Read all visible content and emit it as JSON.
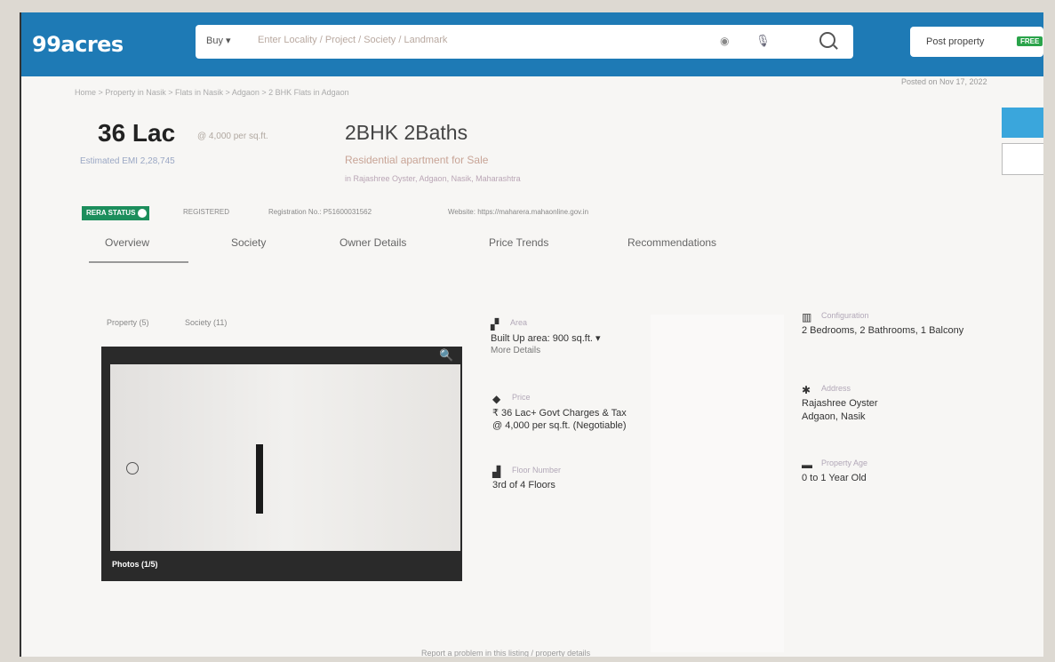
{
  "header": {
    "logo": "99acres",
    "buy_label": "Buy ▾",
    "search_placeholder": "Enter Locality / Project / Society / Landmark",
    "post_property_label": "Post property",
    "free_badge": "FREE",
    "accent_color": "#1e7ab5"
  },
  "breadcrumb": "Home > Property in Nasik > Flats in Nasik > Adgaon > 2 BHK Flats in Adgaon",
  "posted_on": "Posted on Nov 17, 2022",
  "listing": {
    "price": "36 Lac",
    "price_per_sqft": "@ 4,000 per sq.ft.",
    "emi": "Estimated EMI 2,28,745",
    "bhk": "2BHK 2Baths",
    "property_type": "Residential apartment for Sale",
    "location": "in Rajashree Oyster, Adgaon, Nasik, Maharashtra"
  },
  "rera": {
    "badge": "RERA STATUS",
    "status": "REGISTERED",
    "registration": "Registration No.: P51600031562",
    "website": "Website: https://maharera.mahaonline.gov.in"
  },
  "tabs": [
    {
      "label": "Overview"
    },
    {
      "label": "Society"
    },
    {
      "label": "Owner Details"
    },
    {
      "label": "Price Trends"
    },
    {
      "label": "Recommendations"
    }
  ],
  "photo": {
    "subtab_property": "Property (5)",
    "subtab_society": "Society (11)",
    "caption": "Photos (1/5)"
  },
  "details": {
    "area": {
      "label": "Area",
      "value": "Built Up area: 900   sq.ft. ▾",
      "sub": "More Details"
    },
    "configuration": {
      "label": "Configuration",
      "value": "2 Bedrooms, 2 Bathrooms, 1 Balcony"
    },
    "price": {
      "label": "Price",
      "value": "₹ 36 Lac+ Govt Charges & Tax",
      "sub": "@ 4,000 per sq.ft. (Negotiable)"
    },
    "address": {
      "label": "Address",
      "value": "Rajashree Oyster",
      "sub": "Adgaon, Nasik"
    },
    "floor": {
      "label": "Floor Number",
      "value": "3rd  of 4 Floors"
    },
    "age": {
      "label": "Property Age",
      "value": "0 to 1 Year Old"
    }
  },
  "footer": "Report a problem in this listing / property details"
}
